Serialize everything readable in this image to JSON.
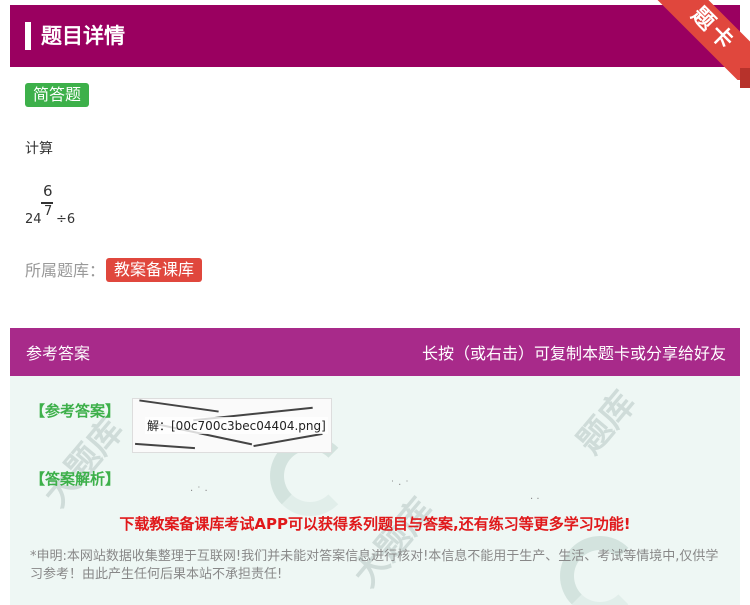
{
  "header": {
    "title": "题目详情"
  },
  "ribbon": {
    "label": "题卡"
  },
  "question": {
    "type_badge": "简答题",
    "prompt": "计算",
    "expression": {
      "lead": "24",
      "numerator": "6",
      "denominator": "7",
      "tail": "÷6"
    },
    "library_label": "所属题库：",
    "library_badge": "教案备课库"
  },
  "answer_bar": {
    "left_label": "参考答案",
    "right_label": "长按（或右击）可复制本题卡或分享给好友"
  },
  "answer_body": {
    "ref_answer_label": "【参考答案】",
    "image_caption": "解：[00c700c3bec04404.png]",
    "analysis_label": "【答案解析】",
    "promo": "下载教案备课库考试APP可以获得系列题目与答案,还有练习等更多学习功能!",
    "disclaimer": "*申明:本网站数据收集整理于互联网!我们并未能对答案信息进行核对!本信息不能用于生产、生活、考试等情境中,仅供学习参考！由此产生任何后果本站不承担责任!"
  },
  "colors": {
    "header_bg": "#9a0060",
    "answer_bar_bg": "#a82a8a",
    "type_badge_bg": "#3db04a",
    "library_badge_bg": "#e0473d",
    "promo_text": "#e0181a",
    "answer_body_bg": "#eef7f4"
  }
}
